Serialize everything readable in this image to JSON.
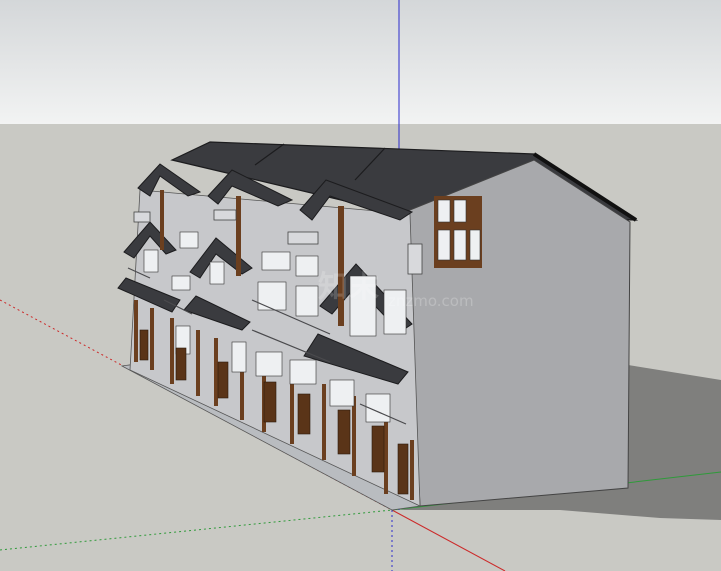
{
  "scene": {
    "colors": {
      "sky_top": "#d4d7d9",
      "sky_bottom": "#f2f3f3",
      "ground": "#c9c9c4",
      "shadow": "#7a7a78",
      "wall_side": "#a8a9ac",
      "wall_front": "#c7c8cb",
      "roof": "#3a3b3f",
      "roof_edge": "#1c1c1e",
      "wood": "#6b3f1f",
      "window": "#eef0f2",
      "axis_red": "#cc2a2a",
      "axis_green": "#2f9a3a",
      "axis_blue": "#2a2acc"
    },
    "watermark": {
      "main": "知末",
      "sub": "znzmo.com"
    }
  }
}
